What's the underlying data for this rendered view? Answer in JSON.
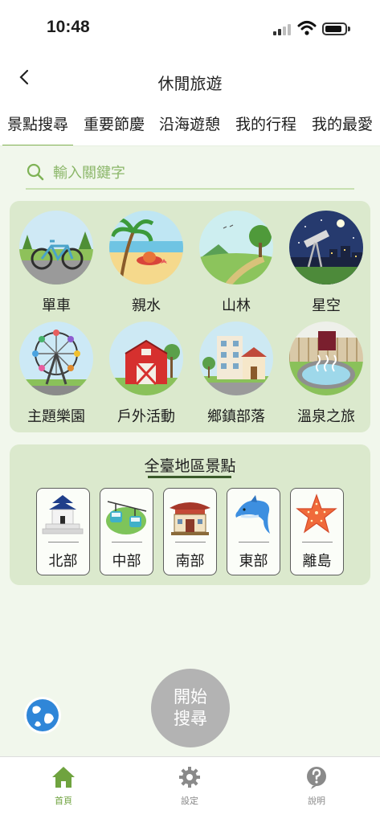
{
  "status_bar": {
    "time": "10:48"
  },
  "header": {
    "title": "休閒旅遊",
    "back_icon": "chevron-left-icon"
  },
  "tabs": [
    {
      "label": "景點搜尋",
      "active": true
    },
    {
      "label": "重要節慶"
    },
    {
      "label": "沿海遊憩"
    },
    {
      "label": "我的行程"
    },
    {
      "label": "我的最愛"
    }
  ],
  "search": {
    "placeholder": "輸入關鍵字",
    "icon": "search-icon"
  },
  "categories": [
    {
      "label": "單車",
      "icon": "bicycle-icon"
    },
    {
      "label": "親水",
      "icon": "beach-icon"
    },
    {
      "label": "山林",
      "icon": "mountain-icon"
    },
    {
      "label": "星空",
      "icon": "telescope-icon"
    },
    {
      "label": "主題樂園",
      "icon": "ferris-wheel-icon"
    },
    {
      "label": "戶外活動",
      "icon": "barn-icon"
    },
    {
      "label": "鄉鎮部落",
      "icon": "town-icon"
    },
    {
      "label": "溫泉之旅",
      "icon": "hot-spring-icon"
    }
  ],
  "regions": {
    "title": "全臺地區景點",
    "items": [
      {
        "label": "北部",
        "icon": "memorial-hall-icon"
      },
      {
        "label": "中部",
        "icon": "cable-car-icon"
      },
      {
        "label": "南部",
        "icon": "temple-icon"
      },
      {
        "label": "東部",
        "icon": "dolphin-icon"
      },
      {
        "label": "離島",
        "icon": "starfish-icon"
      }
    ]
  },
  "start_button": {
    "line1": "開始",
    "line2": "搜尋"
  },
  "bottom_nav": [
    {
      "label": "首頁",
      "icon": "home-icon",
      "active": true
    },
    {
      "label": "設定",
      "icon": "gear-icon"
    },
    {
      "label": "說明",
      "icon": "help-icon"
    }
  ],
  "colors": {
    "accent": "#6fa33f",
    "panel": "#dbe9cd",
    "background": "#f1f7ec"
  }
}
